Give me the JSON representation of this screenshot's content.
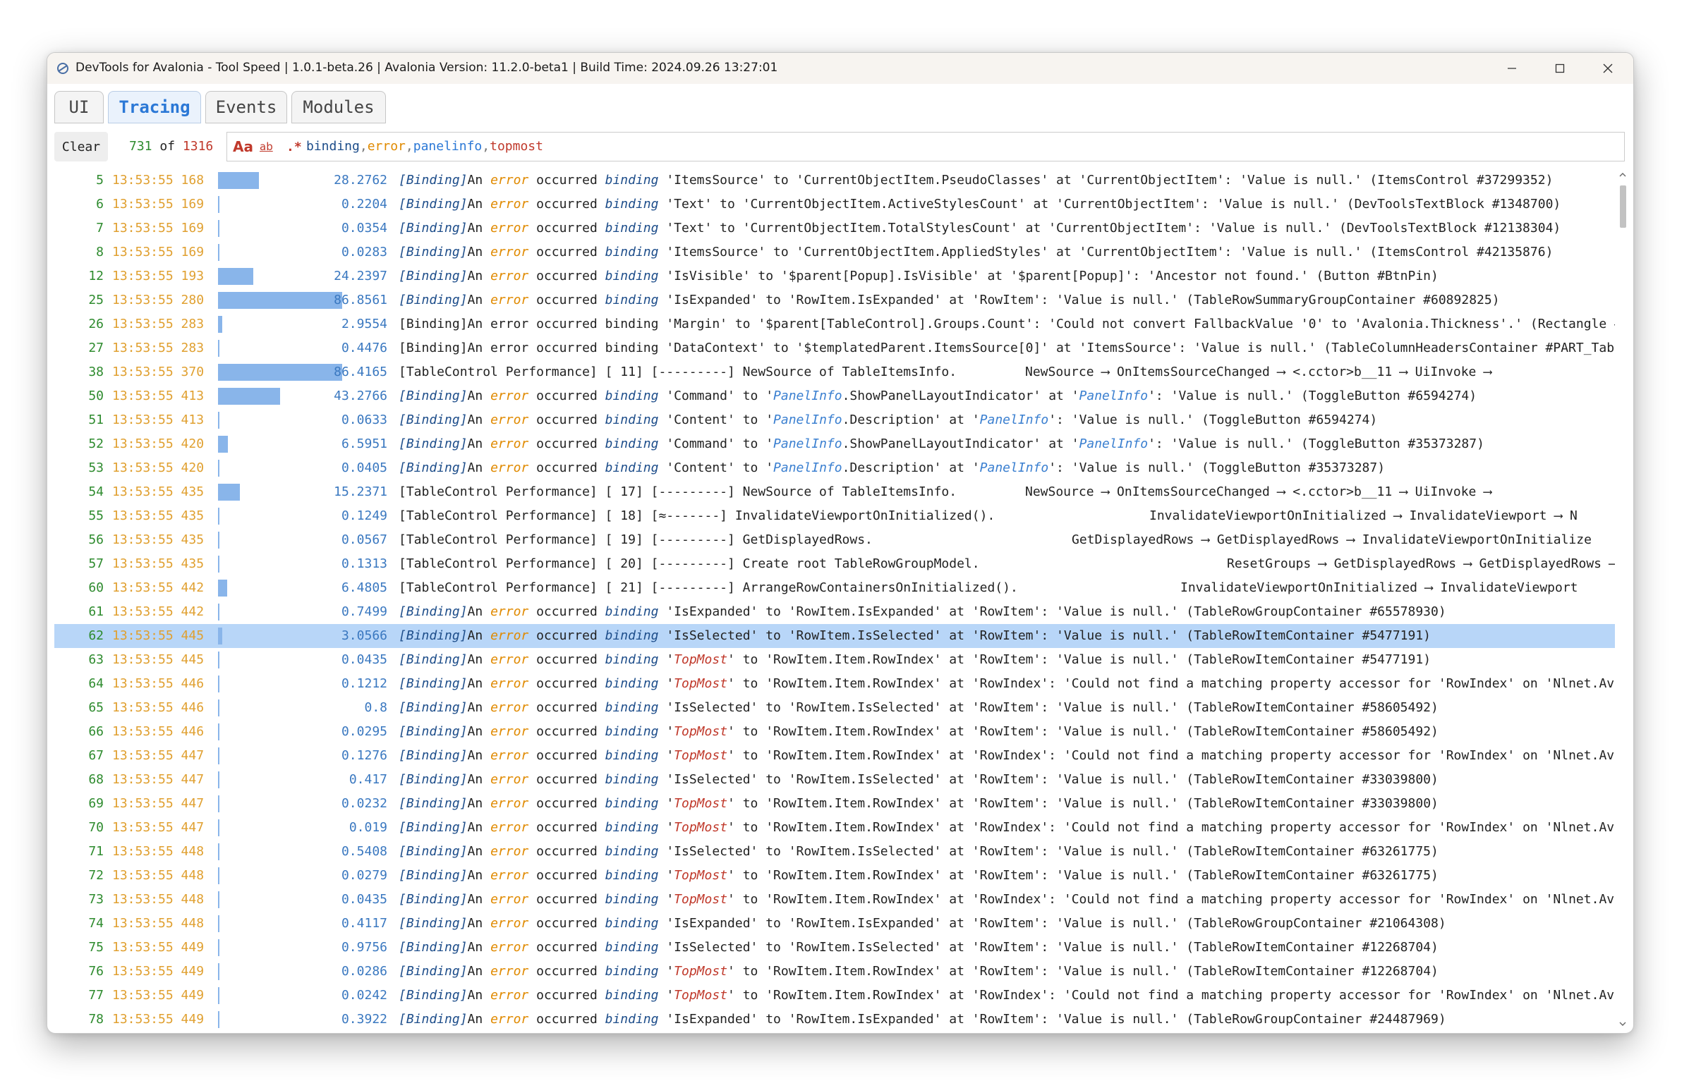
{
  "window": {
    "title": "DevTools for Avalonia - Tool Speed  |  1.0.1-beta.26  |  Avalonia Version: 11.2.0-beta1  |  Build Time: 2024.09.26 13:27:01"
  },
  "tabs": [
    {
      "label": "UI",
      "active": false
    },
    {
      "label": "Tracing",
      "active": true
    },
    {
      "label": "Events",
      "active": false
    },
    {
      "label": "Modules",
      "active": false
    }
  ],
  "toolbar": {
    "clear_label": "Clear",
    "shown_count": "731",
    "of_label": "of",
    "total_count": "1316",
    "option_case_label": "Aa",
    "option_word_label": "ab",
    "option_regex_label": ".*",
    "filter_terms": [
      "binding",
      "error",
      "panelinfo",
      "topmost"
    ],
    "filter_separator": ","
  },
  "colors": {
    "accent": "#2b78d6",
    "id_text": "#2e8b2e",
    "time_text": "#e0a030",
    "duration_bar": "#89b5ea",
    "selected_row": "#b8d6f8",
    "error_word": "#e08a00",
    "topmost_word": "#c0392b"
  },
  "icons": {
    "app": "devtools-logo-icon",
    "minimize": "minimize-icon",
    "maximize": "maximize-icon",
    "close": "close-icon",
    "scroll_up": "chevron-up-icon",
    "scroll_down": "chevron-down-icon"
  },
  "log_rows": [
    {
      "id": "5",
      "time": "13:53:55 168",
      "duration": "28.2762",
      "bar_fraction": 0.29,
      "kind": "binding",
      "prop": "ItemsSource",
      "target": "CurrentObjectItem.PseudoClasses",
      "source": "CurrentObjectItem",
      "reason": "Value is null.",
      "control": "(ItemsControl #37299352)"
    },
    {
      "id": "6",
      "time": "13:53:55 169",
      "duration": "0.2204",
      "bar_fraction": 0,
      "kind": "binding",
      "prop": "Text",
      "target": "CurrentObjectItem.ActiveStylesCount",
      "source": "CurrentObjectItem",
      "reason": "Value is null.",
      "control": "(DevToolsTextBlock #1348700)"
    },
    {
      "id": "7",
      "time": "13:53:55 169",
      "duration": "0.0354",
      "bar_fraction": 0,
      "kind": "binding",
      "prop": "Text",
      "target": "CurrentObjectItem.TotalStylesCount",
      "source": "CurrentObjectItem",
      "reason": "Value is null.",
      "control": "(DevToolsTextBlock #12138304)"
    },
    {
      "id": "8",
      "time": "13:53:55 169",
      "duration": "0.0283",
      "bar_fraction": 0,
      "kind": "binding",
      "prop": "ItemsSource",
      "target": "CurrentObjectItem.AppliedStyles",
      "source": "CurrentObjectItem",
      "reason": "Value is null.",
      "control": "(ItemsControl #42135876)"
    },
    {
      "id": "12",
      "time": "13:53:55 193",
      "duration": "24.2397",
      "bar_fraction": 0.25,
      "kind": "binding",
      "prop": "IsVisible",
      "target": "$parent[Popup].IsVisible",
      "source": "$parent[Popup]",
      "reason": "Ancestor not found.",
      "control": "(Button #BtnPin)"
    },
    {
      "id": "25",
      "time": "13:53:55 280",
      "duration": "86.8561",
      "bar_fraction": 0.88,
      "kind": "binding",
      "prop": "IsExpanded",
      "target": "RowItem.IsExpanded",
      "source": "RowItem",
      "reason": "Value is null.",
      "control": "(TableRowSummaryGroupContainer #60892825)"
    },
    {
      "id": "26",
      "time": "13:53:55 283",
      "duration": "2.9554",
      "bar_fraction": 0.03,
      "kind": "raw",
      "text": "[Binding]An error occurred binding 'Margin' to '$parent[TableControl].Groups.Count': 'Could not convert FallbackValue '0' to 'Avalonia.Thickness'.' (Rectangle #P"
    },
    {
      "id": "27",
      "time": "13:53:55 283",
      "duration": "0.4476",
      "bar_fraction": 0,
      "kind": "raw",
      "text": "[Binding]An error occurred binding 'DataContext' to '$templatedParent.ItemsSource[0]' at 'ItemsSource': 'Value is null.' (TableColumnHeadersContainer #PART_Tab"
    },
    {
      "id": "38",
      "time": "13:53:55 370",
      "duration": "86.4165",
      "bar_fraction": 0.88,
      "kind": "perf",
      "text": "[TableControl Performance] [   11]    [---------] NewSource of TableItemsInfo.",
      "tail": "NewSource ⟶ OnItemsSourceChanged ⟶ <.cctor>b__11 ⟶ UiInvoke ⟶",
      "tail_col": 1376
    },
    {
      "id": "50",
      "time": "13:53:55 413",
      "duration": "43.2766",
      "bar_fraction": 0.44,
      "kind": "binding",
      "prop": "Command",
      "target_pi": "ShowPanelLayoutIndicator",
      "source_pi": true,
      "reason": "Value is null.",
      "control": "(ToggleButton #6594274)"
    },
    {
      "id": "51",
      "time": "13:53:55 413",
      "duration": "0.0633",
      "bar_fraction": 0,
      "kind": "binding",
      "prop": "Content",
      "target_pi": "Description",
      "source_pi": true,
      "reason": "Value is null.",
      "control": "(ToggleButton #6594274)"
    },
    {
      "id": "52",
      "time": "13:53:55 420",
      "duration": "6.5951",
      "bar_fraction": 0.07,
      "kind": "binding",
      "prop": "Command",
      "target_pi": "ShowPanelLayoutIndicator",
      "source_pi": true,
      "reason": "Value is null.",
      "control": "(ToggleButton #35373287)"
    },
    {
      "id": "53",
      "time": "13:53:55 420",
      "duration": "0.0405",
      "bar_fraction": 0,
      "kind": "binding",
      "prop": "Content",
      "target_pi": "Description",
      "source_pi": true,
      "reason": "Value is null.",
      "control": "(ToggleButton #35373287)"
    },
    {
      "id": "54",
      "time": "13:53:55 435",
      "duration": "15.2371",
      "bar_fraction": 0.155,
      "kind": "perf",
      "text": "[TableControl Performance] [   17]    [---------] NewSource of TableItemsInfo.",
      "tail": "NewSource ⟶ OnItemsSourceChanged ⟶ <.cctor>b__11 ⟶ UiInvoke ⟶",
      "tail_col": 1376
    },
    {
      "id": "55",
      "time": "13:53:55 435",
      "duration": "0.1249",
      "bar_fraction": 0,
      "kind": "perf",
      "text": "[TableControl Performance] [   18]      [≈-------] InvalidateViewportOnInitialized().",
      "tail": "InvalidateViewportOnInitialized ⟶ InvalidateViewport ⟶ N",
      "tail_col": 1552
    },
    {
      "id": "56",
      "time": "13:53:55 435",
      "duration": "0.0567",
      "bar_fraction": 0,
      "kind": "perf",
      "text": "[TableControl Performance] [   19]        [---------] GetDisplayedRows.",
      "tail": "GetDisplayedRows ⟶ GetDisplayedRows ⟶ InvalidateViewportOnInitialize",
      "tail_col": 1442
    },
    {
      "id": "57",
      "time": "13:53:55 435",
      "duration": "0.1313",
      "bar_fraction": 0,
      "kind": "perf",
      "text": "[TableControl Performance] [   20]          [---------] Create root TableRowGroupModel.",
      "tail": "ResetGroups ⟶ GetDisplayedRows ⟶ GetDisplayedRows ⟶",
      "tail_col": 1662
    },
    {
      "id": "60",
      "time": "13:53:55 442",
      "duration": "6.4805",
      "bar_fraction": 0.066,
      "kind": "perf",
      "text": "[TableControl Performance] [   21]        [---------] ArrangeRowContainersOnInitialized().",
      "tail": "InvalidateViewportOnInitialized ⟶ InvalidateViewport",
      "tail_col": 1596
    },
    {
      "id": "61",
      "time": "13:53:55 442",
      "duration": "0.7499",
      "bar_fraction": 0,
      "kind": "binding",
      "prop": "IsExpanded",
      "target": "RowItem.IsExpanded",
      "source": "RowItem",
      "reason": "Value is null.",
      "control": "(TableRowGroupContainer #65578930)"
    },
    {
      "id": "62",
      "time": "13:53:55 445",
      "duration": "3.0566",
      "bar_fraction": 0.031,
      "kind": "binding",
      "selected": true,
      "prop": "IsSelected",
      "target": "RowItem.IsSelected",
      "source": "RowItem",
      "reason": "Value is null.",
      "control": "(TableRowItemContainer #5477191)"
    },
    {
      "id": "63",
      "time": "13:53:55 445",
      "duration": "0.0435",
      "bar_fraction": 0,
      "kind": "topmost",
      "target": "RowItem.Item.RowIndex",
      "source": "RowItem",
      "reason": "Value is null.",
      "control": "(TableRowItemContainer #5477191)"
    },
    {
      "id": "64",
      "time": "13:53:55 446",
      "duration": "0.1212",
      "bar_fraction": 0,
      "kind": "topmost",
      "target": "RowItem.Item.RowIndex",
      "source": "RowIndex",
      "reason": "Could not find a matching property accessor for 'RowIndex' on 'Nlnet.Ava",
      "control": ""
    },
    {
      "id": "65",
      "time": "13:53:55 446",
      "duration": "0.8",
      "bar_fraction": 0,
      "kind": "binding",
      "prop": "IsSelected",
      "target": "RowItem.IsSelected",
      "source": "RowItem",
      "reason": "Value is null.",
      "control": "(TableRowItemContainer #58605492)"
    },
    {
      "id": "66",
      "time": "13:53:55 446",
      "duration": "0.0295",
      "bar_fraction": 0,
      "kind": "topmost",
      "target": "RowItem.Item.RowIndex",
      "source": "RowItem",
      "reason": "Value is null.",
      "control": "(TableRowItemContainer #58605492)"
    },
    {
      "id": "67",
      "time": "13:53:55 447",
      "duration": "0.1276",
      "bar_fraction": 0,
      "kind": "topmost",
      "target": "RowItem.Item.RowIndex",
      "source": "RowIndex",
      "reason": "Could not find a matching property accessor for 'RowIndex' on 'Nlnet.Ava",
      "control": ""
    },
    {
      "id": "68",
      "time": "13:53:55 447",
      "duration": "0.417",
      "bar_fraction": 0,
      "kind": "binding",
      "prop": "IsSelected",
      "target": "RowItem.IsSelected",
      "source": "RowItem",
      "reason": "Value is null.",
      "control": "(TableRowItemContainer #33039800)"
    },
    {
      "id": "69",
      "time": "13:53:55 447",
      "duration": "0.0232",
      "bar_fraction": 0,
      "kind": "topmost",
      "target": "RowItem.Item.RowIndex",
      "source": "RowItem",
      "reason": "Value is null.",
      "control": "(TableRowItemContainer #33039800)"
    },
    {
      "id": "70",
      "time": "13:53:55 447",
      "duration": "0.019",
      "bar_fraction": 0,
      "kind": "topmost",
      "target": "RowItem.Item.RowIndex",
      "source": "RowIndex",
      "reason": "Could not find a matching property accessor for 'RowIndex' on 'Nlnet.Ava",
      "control": ""
    },
    {
      "id": "71",
      "time": "13:53:55 448",
      "duration": "0.5408",
      "bar_fraction": 0,
      "kind": "binding",
      "prop": "IsSelected",
      "target": "RowItem.IsSelected",
      "source": "RowItem",
      "reason": "Value is null.",
      "control": "(TableRowItemContainer #63261775)"
    },
    {
      "id": "72",
      "time": "13:53:55 448",
      "duration": "0.0279",
      "bar_fraction": 0,
      "kind": "topmost",
      "target": "RowItem.Item.RowIndex",
      "source": "RowItem",
      "reason": "Value is null.",
      "control": "(TableRowItemContainer #63261775)"
    },
    {
      "id": "73",
      "time": "13:53:55 448",
      "duration": "0.0435",
      "bar_fraction": 0,
      "kind": "topmost",
      "target": "RowItem.Item.RowIndex",
      "source": "RowIndex",
      "reason": "Could not find a matching property accessor for 'RowIndex' on 'Nlnet.Ava",
      "control": ""
    },
    {
      "id": "74",
      "time": "13:53:55 448",
      "duration": "0.4117",
      "bar_fraction": 0,
      "kind": "binding",
      "prop": "IsExpanded",
      "target": "RowItem.IsExpanded",
      "source": "RowItem",
      "reason": "Value is null.",
      "control": "(TableRowGroupContainer #21064308)"
    },
    {
      "id": "75",
      "time": "13:53:55 449",
      "duration": "0.9756",
      "bar_fraction": 0,
      "kind": "binding",
      "prop": "IsSelected",
      "target": "RowItem.IsSelected",
      "source": "RowItem",
      "reason": "Value is null.",
      "control": "(TableRowItemContainer #12268704)"
    },
    {
      "id": "76",
      "time": "13:53:55 449",
      "duration": "0.0286",
      "bar_fraction": 0,
      "kind": "topmost",
      "target": "RowItem.Item.RowIndex",
      "source": "RowItem",
      "reason": "Value is null.",
      "control": "(TableRowItemContainer #12268704)"
    },
    {
      "id": "77",
      "time": "13:53:55 449",
      "duration": "0.0242",
      "bar_fraction": 0,
      "kind": "topmost",
      "target": "RowItem.Item.RowIndex",
      "source": "RowIndex",
      "reason": "Could not find a matching property accessor for 'RowIndex' on 'Nlnet.Ava",
      "control": ""
    },
    {
      "id": "78",
      "time": "13:53:55 449",
      "duration": "0.3922",
      "bar_fraction": 0,
      "kind": "binding",
      "prop": "IsExpanded",
      "target": "RowItem.IsExpanded",
      "source": "RowItem",
      "reason": "Value is null.",
      "control": "(TableRowGroupContainer #24487969)"
    }
  ]
}
